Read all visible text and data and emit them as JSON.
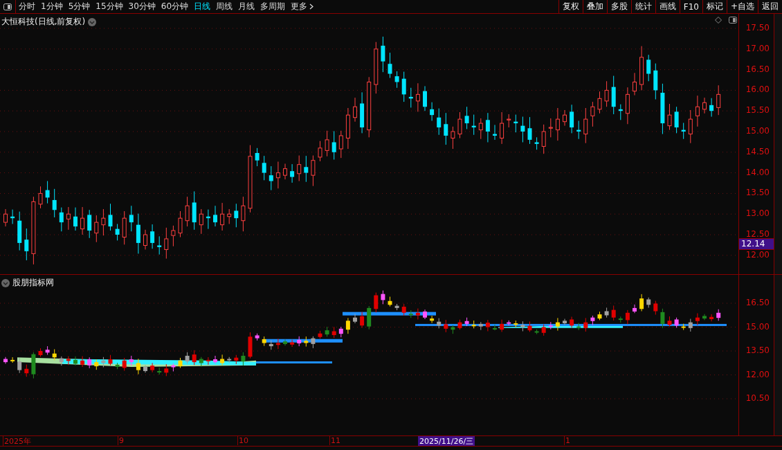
{
  "toolbar": {
    "periods": [
      {
        "label": "分时",
        "selected": false
      },
      {
        "label": "1分钟",
        "selected": false
      },
      {
        "label": "5分钟",
        "selected": false
      },
      {
        "label": "15分钟",
        "selected": false
      },
      {
        "label": "30分钟",
        "selected": false
      },
      {
        "label": "60分钟",
        "selected": false
      },
      {
        "label": "日线",
        "selected": true
      },
      {
        "label": "周线",
        "selected": false
      },
      {
        "label": "月线",
        "selected": false
      },
      {
        "label": "多周期",
        "selected": false
      }
    ],
    "more": "更多",
    "actions": [
      "复权",
      "叠加",
      "多股",
      "统计",
      "画线",
      "F10",
      "标记",
      "+自选",
      "返回"
    ]
  },
  "main_chart": {
    "title": "大恒科技(日线,前复权)",
    "price_axis": [
      "17.50",
      "17.00",
      "16.50",
      "16.00",
      "15.50",
      "15.00",
      "14.50",
      "14.00",
      "13.50",
      "13.00",
      "12.50",
      "12.00"
    ],
    "current_price": "12.14"
  },
  "indicator": {
    "title": "股朋指标网",
    "axis": [
      "16.50",
      "15.00",
      "13.50",
      "12.00",
      "10.50"
    ]
  },
  "date_axis": {
    "labels": [
      "2025年",
      "9",
      "10",
      "11",
      "1"
    ],
    "cursor_date": "2025/11/26/三"
  }
}
